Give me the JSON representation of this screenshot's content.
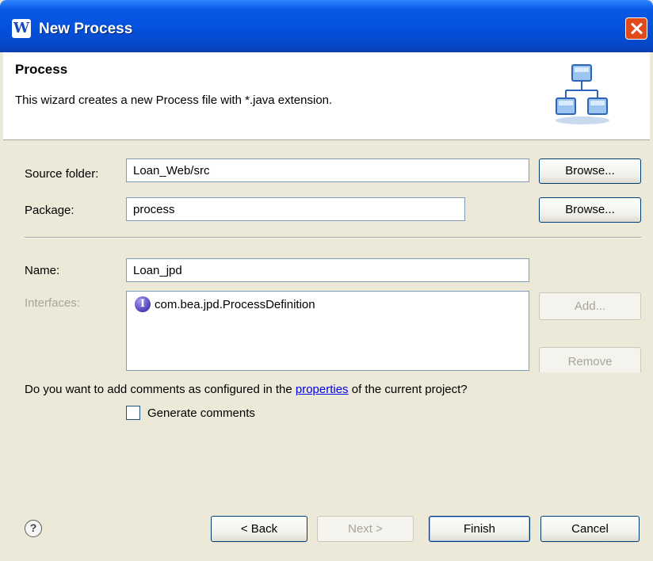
{
  "window": {
    "title": "New Process",
    "app_icon_glyph": "W"
  },
  "banner": {
    "title": "Process",
    "description": "This wizard creates a new Process file with *.java extension.",
    "icon": "hierarchy-icon"
  },
  "form": {
    "source_folder": {
      "label": "Source folder:",
      "value": "Loan_Web/src",
      "browse_label": "Browse..."
    },
    "package": {
      "label": "Package:",
      "value": "process",
      "browse_label": "Browse..."
    },
    "name": {
      "label": "Name:",
      "value": "Loan_jpd"
    },
    "interfaces": {
      "label": "Interfaces:",
      "items": [
        {
          "icon_glyph": "I",
          "text": "com.bea.jpd.ProcessDefinition"
        }
      ],
      "add_label": "Add...",
      "remove_label": "Remove"
    },
    "comments": {
      "question_prefix": "Do you want to add comments as configured in the ",
      "link_text": "properties",
      "question_suffix": " of the current project?",
      "checkbox_label": "Generate comments",
      "checked": false
    }
  },
  "footer": {
    "help_glyph": "?",
    "back_label": "< Back",
    "next_label": "Next >",
    "finish_label": "Finish",
    "cancel_label": "Cancel"
  },
  "colors": {
    "titlebar": "#0451dc",
    "dialog_bg": "#ece9d8",
    "close_button": "#e24a1c",
    "link": "#0000ee"
  }
}
